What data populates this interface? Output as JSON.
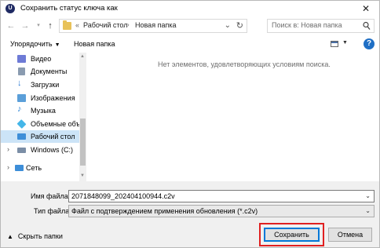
{
  "window": {
    "title": "Сохранить статус ключа как",
    "app_icon_letter": "U"
  },
  "nav": {
    "breadcrumb_prefix": "«",
    "breadcrumb": [
      "Рабочий стол",
      "Новая папка"
    ],
    "search_placeholder": "Поиск в: Новая папка"
  },
  "toolbar": {
    "organize": "Упорядочить",
    "new_folder": "Новая папка"
  },
  "sidebar": {
    "items": [
      {
        "label": "Видео",
        "icon": "video-icon",
        "color": "#6e7bd6"
      },
      {
        "label": "Документы",
        "icon": "documents-icon",
        "color": "#8a9bb0"
      },
      {
        "label": "Загрузки",
        "icon": "downloads-icon",
        "color": "#2b79d3"
      },
      {
        "label": "Изображения",
        "icon": "pictures-icon",
        "color": "#5b9fd9"
      },
      {
        "label": "Музыка",
        "icon": "music-icon",
        "color": "#2f86d6"
      },
      {
        "label": "Объемные объ",
        "icon": "3d-objects-icon",
        "color": "#44b6e8"
      },
      {
        "label": "Рабочий стол",
        "icon": "desktop-icon",
        "color": "#3d8ed8",
        "selected": true
      },
      {
        "label": "Windows (C:)",
        "icon": "drive-icon",
        "color": "#7b8ea6"
      },
      {
        "label": "Сеть",
        "icon": "network-icon",
        "color": "#3d8ed8"
      }
    ]
  },
  "content": {
    "empty_message": "Нет элементов, удовлетворяющих условиям поиска."
  },
  "form": {
    "filename_label": "Имя файла:",
    "filename_value": "2071848099_202404100944.c2v",
    "filetype_label": "Тип файла:",
    "filetype_value": "Файл с подтверждением применения обновления (*.c2v)"
  },
  "footer": {
    "hide_folders": "Скрыть папки",
    "save": "Сохранить",
    "cancel": "Отмена"
  },
  "colors": {
    "highlight": "#e02020",
    "selection": "#cce4f7",
    "accent": "#0078d7"
  }
}
